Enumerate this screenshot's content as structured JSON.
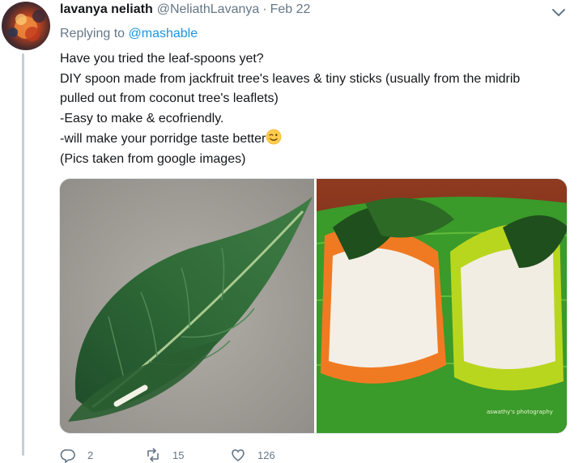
{
  "tweet": {
    "display_name": "lavanya neliath",
    "handle": "@NeliathLavanya",
    "separator": "·",
    "date": "Feb 22",
    "replying_prefix": "Replying to",
    "replying_mention": "@mashable",
    "lines": [
      "Have you tried the leaf-spoons yet?",
      "DIY spoon made from jackfruit tree's leaves & tiny sticks (usually from the midrib",
      "pulled out from coconut tree's leaflets)",
      "-Easy to make & ecofriendly.",
      "-will make your porridge taste better",
      "(Pics taken from google images)"
    ],
    "emoji": "winking-face-emoji",
    "photo_watermark": "aswathy's photography",
    "actions": {
      "reply_count": "2",
      "retweet_count": "15",
      "like_count": "126"
    }
  },
  "icons": {
    "caret": "chevron-down-icon",
    "reply": "reply-icon",
    "retweet": "retweet-icon",
    "like": "heart-icon"
  },
  "colors": {
    "link": "#1b95e0",
    "secondary_text": "#657786",
    "primary_text": "#14171a",
    "thread_line": "#c4cfd6"
  }
}
